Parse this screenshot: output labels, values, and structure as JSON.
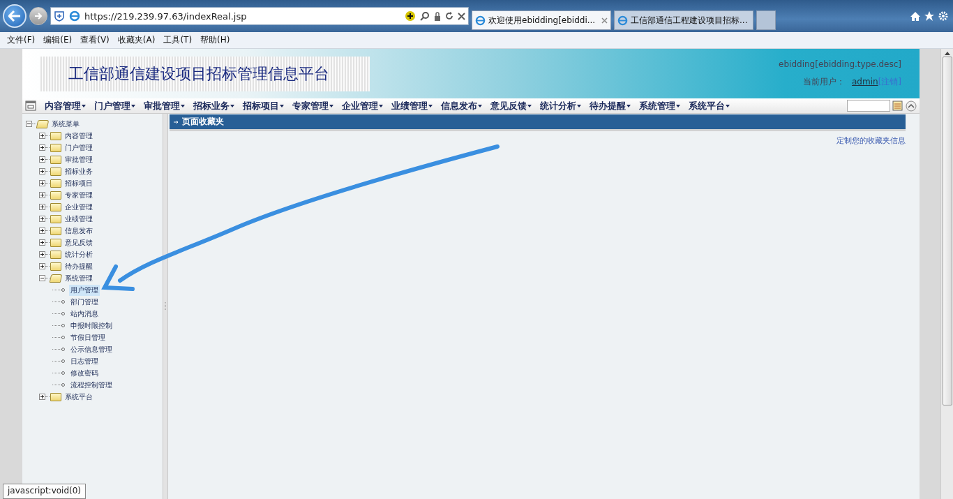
{
  "browser": {
    "address": "https://219.239.97.63/indexReal.jsp",
    "tabs": [
      {
        "title": "欢迎使用ebidding[ebiddi...",
        "selected": true
      },
      {
        "title": "工信部通信工程建设项目招标...",
        "selected": false
      }
    ],
    "menu": [
      "文件(F)",
      "编辑(E)",
      "查看(V)",
      "收藏夹(A)",
      "工具(T)",
      "帮助(H)"
    ],
    "status_text": "javascript:void(0)"
  },
  "header": {
    "title": "工信部通信建设项目招标管理信息平台",
    "type_desc": "ebidding[ebidding.type.desc]",
    "user_label": "当前用户：",
    "user": "admin",
    "logout": "[注销]"
  },
  "nav": [
    "内容管理",
    "门户管理",
    "审批管理",
    "招标业务",
    "招标项目",
    "专家管理",
    "企业管理",
    "业绩管理",
    "信息发布",
    "意见反馈",
    "统计分析",
    "待办提醒",
    "系统管理",
    "系统平台"
  ],
  "tree": [
    {
      "label": "系统菜单",
      "kind": "folder",
      "expanded": true,
      "children": [
        {
          "label": "内容管理",
          "kind": "folder",
          "expanded": false
        },
        {
          "label": "门户管理",
          "kind": "folder",
          "expanded": false
        },
        {
          "label": "审批管理",
          "kind": "folder",
          "expanded": false
        },
        {
          "label": "招标业务",
          "kind": "folder",
          "expanded": false
        },
        {
          "label": "招标项目",
          "kind": "folder",
          "expanded": false
        },
        {
          "label": "专家管理",
          "kind": "folder",
          "expanded": false
        },
        {
          "label": "企业管理",
          "kind": "folder",
          "expanded": false
        },
        {
          "label": "业绩管理",
          "kind": "folder",
          "expanded": false
        },
        {
          "label": "信息发布",
          "kind": "folder",
          "expanded": false
        },
        {
          "label": "意见反馈",
          "kind": "folder",
          "expanded": false
        },
        {
          "label": "统计分析",
          "kind": "folder",
          "expanded": false
        },
        {
          "label": "待办提醒",
          "kind": "folder",
          "expanded": false
        },
        {
          "label": "系统管理",
          "kind": "folder",
          "expanded": true,
          "children": [
            {
              "label": "用户管理",
              "kind": "leaf",
              "selected": true
            },
            {
              "label": "部门管理",
              "kind": "leaf",
              "selected": false
            },
            {
              "label": "站内消息",
              "kind": "leaf",
              "selected": false
            },
            {
              "label": "申报时限控制",
              "kind": "leaf",
              "selected": false
            },
            {
              "label": "节假日管理",
              "kind": "leaf",
              "selected": false
            },
            {
              "label": "公示信息管理",
              "kind": "leaf",
              "selected": false
            },
            {
              "label": "日志管理",
              "kind": "leaf",
              "selected": false
            },
            {
              "label": "修改密码",
              "kind": "leaf",
              "selected": false
            },
            {
              "label": "流程控制管理",
              "kind": "leaf",
              "selected": false
            }
          ]
        },
        {
          "label": "系统平台",
          "kind": "folder",
          "expanded": false
        }
      ]
    }
  ],
  "panel": {
    "title": "页面收藏夹",
    "link": "定制您的收藏夹信息"
  }
}
